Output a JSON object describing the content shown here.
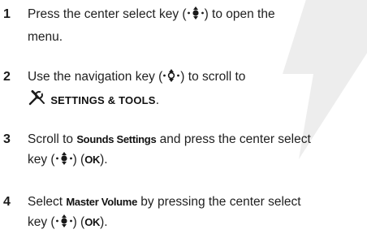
{
  "steps": [
    {
      "number": "1",
      "text_a": "Press the center select key (",
      "icon": "center-select-key-icon",
      "text_b": ") to open the",
      "line2": "menu."
    },
    {
      "number": "2",
      "text_a": "Use the navigation key (",
      "icon": "navigation-key-icon",
      "text_b": ") to scroll to",
      "tools_icon": "settings-tools-icon",
      "menu_label": "SETTINGS & TOOLS",
      "text_c": "."
    },
    {
      "number": "3",
      "text_a": "Scroll to ",
      "bold_term": "Sounds Settings",
      "text_b": " and press the center select",
      "line2_a": "key (",
      "icon": "center-select-key-icon",
      "line2_b": ") (",
      "ok": "OK",
      "line2_c": ")."
    },
    {
      "number": "4",
      "text_a": "Select ",
      "bold_term": "Master Volume",
      "text_b": " by pressing the center select",
      "line2_a": "key (",
      "icon": "center-select-key-icon",
      "line2_b": ") (",
      "ok": "OK",
      "line2_c": ")."
    }
  ],
  "colors": {
    "text": "#1f1f1f",
    "watermark": "#d8d8d8"
  }
}
